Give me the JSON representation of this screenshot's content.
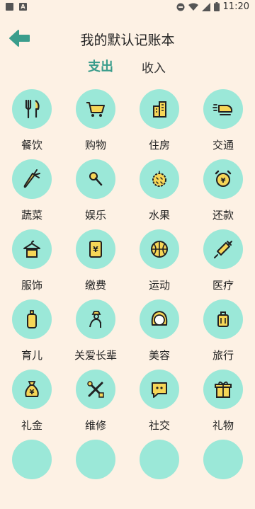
{
  "status": {
    "time": "11:20",
    "notif_a": "A"
  },
  "header": {
    "title": "我的默认记账本"
  },
  "tabs": {
    "expense": "支出",
    "income": "收入"
  },
  "categories": [
    {
      "label": "餐饮",
      "icon": "utensils-icon"
    },
    {
      "label": "购物",
      "icon": "shopping-cart-icon"
    },
    {
      "label": "住房",
      "icon": "buildings-icon"
    },
    {
      "label": "交通",
      "icon": "train-icon"
    },
    {
      "label": "蔬菜",
      "icon": "carrot-icon"
    },
    {
      "label": "娱乐",
      "icon": "microphone-icon"
    },
    {
      "label": "水果",
      "icon": "durian-icon"
    },
    {
      "label": "还款",
      "icon": "alarm-clock-yen-icon"
    },
    {
      "label": "服饰",
      "icon": "hanger-shirt-icon"
    },
    {
      "label": "缴费",
      "icon": "bill-yen-icon"
    },
    {
      "label": "运动",
      "icon": "basketball-icon"
    },
    {
      "label": "医疗",
      "icon": "syringe-icon"
    },
    {
      "label": "育儿",
      "icon": "baby-bottle-icon"
    },
    {
      "label": "关爱长辈",
      "icon": "elder-person-icon"
    },
    {
      "label": "美容",
      "icon": "woman-face-icon"
    },
    {
      "label": "旅行",
      "icon": "suitcase-icon"
    },
    {
      "label": "礼金",
      "icon": "money-bag-yen-icon"
    },
    {
      "label": "维修",
      "icon": "tools-icon"
    },
    {
      "label": "社交",
      "icon": "chat-bubble-icon"
    },
    {
      "label": "礼物",
      "icon": "gift-box-icon"
    }
  ],
  "colors": {
    "accent": "#3a9d8c",
    "circle": "#9be8d8",
    "background": "#fdf1e4",
    "icon_fill": "#f6d657"
  }
}
